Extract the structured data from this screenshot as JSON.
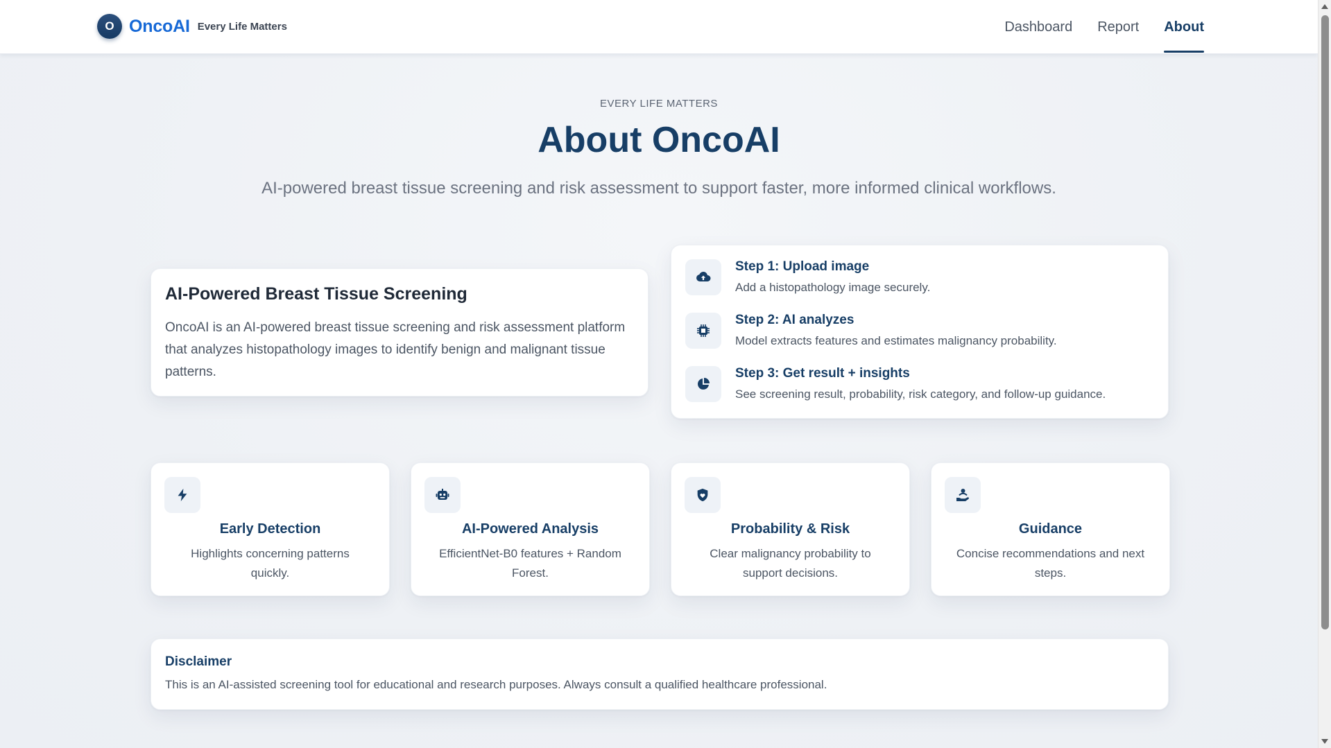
{
  "brand": {
    "logo_letter": "O",
    "name": "OncoAI",
    "tagline": "Every Life Matters"
  },
  "nav": {
    "items": [
      {
        "label": "Dashboard",
        "active": false
      },
      {
        "label": "Report",
        "active": false
      },
      {
        "label": "About",
        "active": true
      }
    ]
  },
  "hero": {
    "eyebrow": "EVERY LIFE MATTERS",
    "title": "About OncoAI",
    "subtitle": "AI-powered breast tissue screening and risk assessment to support faster, more informed clinical workflows."
  },
  "intro": {
    "title": "AI-Powered Breast Tissue Screening",
    "text": "OncoAI is an AI-powered breast tissue screening and risk assessment platform that analyzes histopathology images to identify benign and malignant tissue patterns."
  },
  "steps": [
    {
      "icon": "cloud-upload-icon",
      "title": "Step 1: Upload image",
      "desc": "Add a histopathology image securely."
    },
    {
      "icon": "cpu-chip-icon",
      "title": "Step 2: AI analyzes",
      "desc": "Model extracts features and estimates malignancy probability."
    },
    {
      "icon": "pie-chart-icon",
      "title": "Step 3: Get result + insights",
      "desc": "See screening result, probability, risk category, and follow-up guidance."
    }
  ],
  "features": [
    {
      "icon": "lightning-bolt-icon",
      "title": "Early Detection",
      "desc": "Highlights concerning patterns quickly."
    },
    {
      "icon": "robot-icon",
      "title": "AI-Powered Analysis",
      "desc": "EfficientNet-B0 features + Random Forest."
    },
    {
      "icon": "shield-heart-icon",
      "title": "Probability & Risk",
      "desc": "Clear malignancy probability to support decisions."
    },
    {
      "icon": "hand-holding-person-icon",
      "title": "Guidance",
      "desc": "Concise recommendations and next steps."
    }
  ],
  "disclaimer": {
    "title": "Disclaimer",
    "text": "This is an AI-assisted screening tool for educational and research purposes. Always consult a qualified healthcare professional."
  },
  "colors": {
    "primary": "#173e66",
    "brand_blue": "#1769d6",
    "icon_bg": "#eef2f7"
  }
}
